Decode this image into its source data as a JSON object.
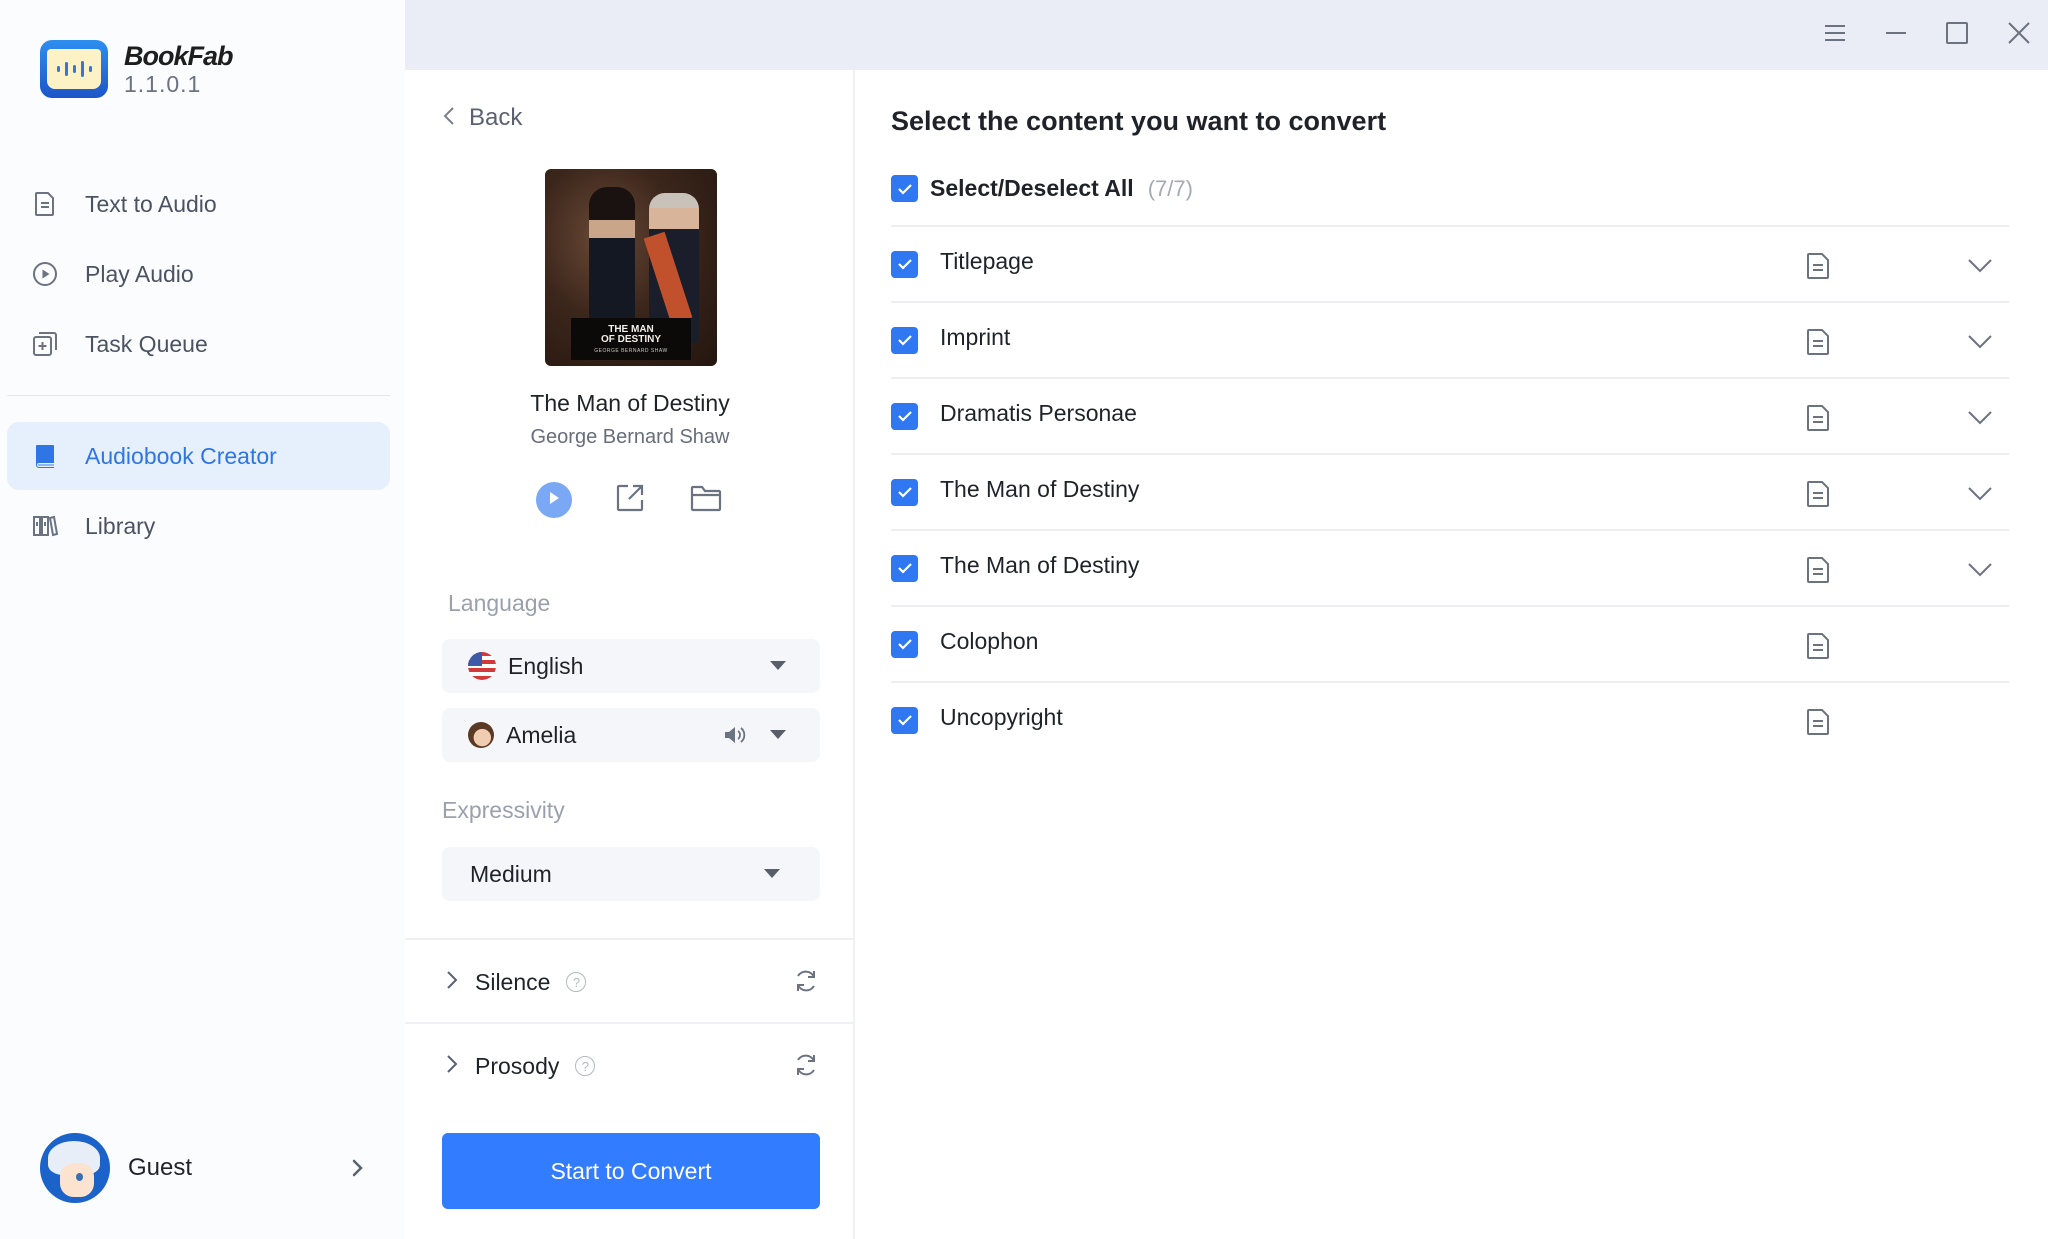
{
  "app": {
    "name": "BookFab",
    "version": "1.1.0.1"
  },
  "window_controls": {
    "menu": "menu-icon",
    "minimize": "minimize-icon",
    "maximize": "maximize-icon",
    "close": "close-icon"
  },
  "sidebar": {
    "items": [
      {
        "label": "Text to Audio",
        "icon": "document-icon",
        "active": false
      },
      {
        "label": "Play Audio",
        "icon": "play-circle-icon",
        "active": false
      },
      {
        "label": "Task Queue",
        "icon": "task-queue-icon",
        "active": false
      },
      {
        "label": "Audiobook Creator",
        "icon": "book-icon",
        "active": true
      },
      {
        "label": "Library",
        "icon": "library-icon",
        "active": false
      }
    ],
    "user": {
      "name": "Guest"
    }
  },
  "book_panel": {
    "back_label": "Back",
    "cover": {
      "title_line1": "THE MAN",
      "title_line2": "OF DESTINY",
      "author": "GEORGE BERNARD SHAW"
    },
    "title": "The Man of Destiny",
    "author": "George Bernard Shaw",
    "language_label": "Language",
    "language_value": "English",
    "voice_value": "Amelia",
    "expressivity_label": "Expressivity",
    "expressivity_value": "Medium",
    "silence_label": "Silence",
    "prosody_label": "Prosody",
    "help_glyph": "?",
    "convert_button": "Start to Convert"
  },
  "content_panel": {
    "title": "Select the content you want to convert",
    "select_all_label": "Select/Deselect All",
    "select_all_count": "(7/7)",
    "items": [
      {
        "label": "Titlepage",
        "checked": true,
        "expandable": true
      },
      {
        "label": "Imprint",
        "checked": true,
        "expandable": true
      },
      {
        "label": "Dramatis Personae",
        "checked": true,
        "expandable": true
      },
      {
        "label": "The Man of Destiny",
        "checked": true,
        "expandable": true
      },
      {
        "label": "The Man of Destiny",
        "checked": true,
        "expandable": true
      },
      {
        "label": "Colophon",
        "checked": true,
        "expandable": false
      },
      {
        "label": "Uncopyright",
        "checked": true,
        "expandable": false
      }
    ]
  },
  "colors": {
    "accent": "#327cff",
    "active_nav_bg": "#e6f0fd",
    "topbar_bg": "#eaedf5",
    "checkbox": "#3078f2"
  }
}
